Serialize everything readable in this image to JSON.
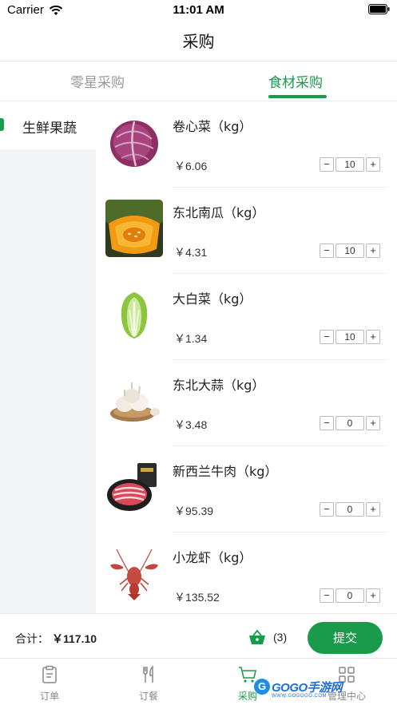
{
  "status_bar": {
    "carrier": "Carrier",
    "time": "11:01 AM"
  },
  "nav": {
    "title": "采购"
  },
  "tabs": [
    {
      "label": "零星采购",
      "active": false
    },
    {
      "label": "食材采购",
      "active": true
    }
  ],
  "categories": [
    {
      "label": "生鲜果蔬",
      "active": true
    }
  ],
  "products": [
    {
      "name": "卷心菜（kg）",
      "price": "￥6.06",
      "qty": "10",
      "image": "red-cabbage"
    },
    {
      "name": "东北南瓜（kg）",
      "price": "￥4.31",
      "qty": "10",
      "image": "pumpkin"
    },
    {
      "name": "大白菜（kg）",
      "price": "￥1.34",
      "qty": "10",
      "image": "napa-cabbage"
    },
    {
      "name": "东北大蒜（kg）",
      "price": "￥3.48",
      "qty": "0",
      "image": "garlic"
    },
    {
      "name": "新西兰牛肉（kg）",
      "price": "￥95.39",
      "qty": "0",
      "image": "beef"
    },
    {
      "name": "小龙虾（kg）",
      "price": "￥135.52",
      "qty": "0",
      "image": "crayfish"
    }
  ],
  "stepper": {
    "minus": "−",
    "plus": "+"
  },
  "summary": {
    "total_label": "合计：",
    "total_value": "￥117.10",
    "basket_count": "(3)",
    "submit_label": "提交"
  },
  "tab_bar": [
    {
      "label": "订单",
      "icon": "clipboard-icon",
      "active": false
    },
    {
      "label": "订餐",
      "icon": "cutlery-icon",
      "active": false
    },
    {
      "label": "采购",
      "icon": "cart-icon",
      "active": true
    },
    {
      "label": "管理中心",
      "icon": "grid-icon",
      "active": false
    }
  ],
  "watermark": {
    "letter": "G",
    "text": "GOGO手游网",
    "sub": "WWW.GOGOGO.COM"
  },
  "colors": {
    "accent": "#1a9a4b",
    "sidebar_bg": "#f3f4f6",
    "watermark": "#1d6fd6"
  }
}
